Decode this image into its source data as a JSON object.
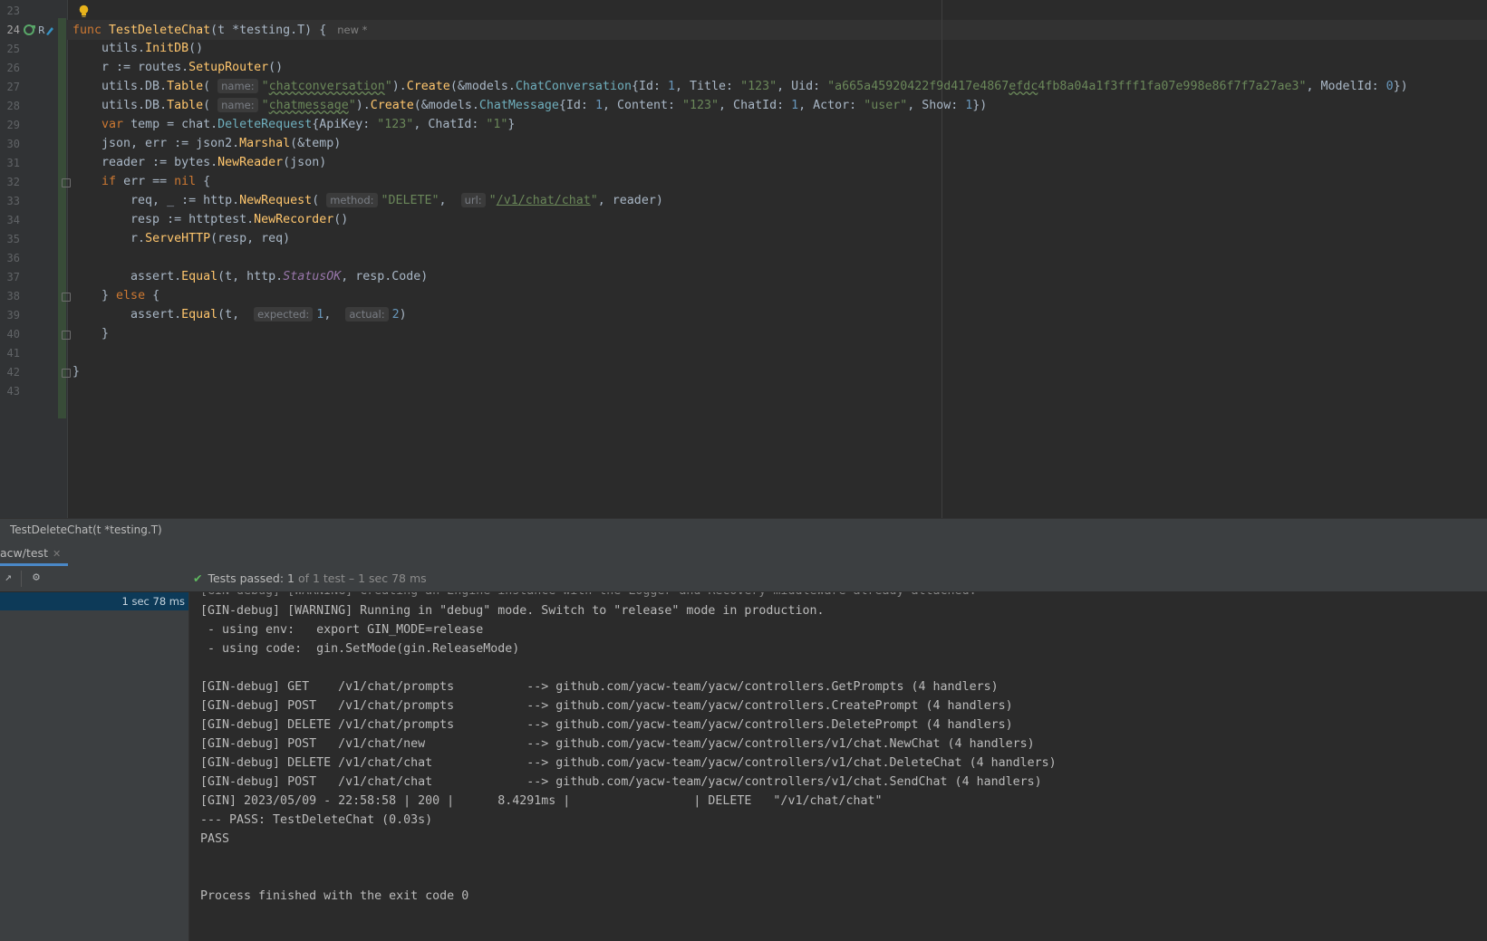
{
  "editor": {
    "lines": [
      {
        "n": "23",
        "segs": []
      },
      {
        "n": "24",
        "current": true,
        "segs": [
          {
            "t": "func ",
            "c": "kw"
          },
          {
            "t": "TestDeleteChat",
            "c": "fn"
          },
          {
            "t": "(t *testing.T) {"
          },
          {
            "t": "new *",
            "c": "inlay"
          }
        ]
      },
      {
        "n": "25",
        "segs": [
          {
            "t": "    utils."
          },
          {
            "t": "InitDB",
            "c": "call"
          },
          {
            "t": "()"
          }
        ]
      },
      {
        "n": "26",
        "segs": [
          {
            "t": "    r := routes."
          },
          {
            "t": "SetupRouter",
            "c": "call"
          },
          {
            "t": "()"
          }
        ]
      },
      {
        "n": "27",
        "segs": [
          {
            "t": "    utils.DB."
          },
          {
            "t": "Table",
            "c": "call"
          },
          {
            "t": "( "
          },
          {
            "t": "name:",
            "c": "hint"
          },
          {
            "t": "\"",
            "c": "str"
          },
          {
            "t": "chatconversation",
            "c": "str squig"
          },
          {
            "t": "\"",
            "c": "str"
          },
          {
            "t": ")."
          },
          {
            "t": "Create",
            "c": "call"
          },
          {
            "t": "(&models."
          },
          {
            "t": "ChatConversation",
            "c": "typ"
          },
          {
            "t": "{Id: "
          },
          {
            "t": "1",
            "c": "num"
          },
          {
            "t": ", Title: "
          },
          {
            "t": "\"123\"",
            "c": "str"
          },
          {
            "t": ", Uid: "
          },
          {
            "t": "\"a665a45920422f9d417e4867",
            "c": "str"
          },
          {
            "t": "efdc",
            "c": "str squig"
          },
          {
            "t": "4fb8a04a1f3fff1fa07e998e86f7f7a27ae3\"",
            "c": "str"
          },
          {
            "t": ", ModelId: "
          },
          {
            "t": "0",
            "c": "num"
          },
          {
            "t": "})"
          }
        ]
      },
      {
        "n": "28",
        "segs": [
          {
            "t": "    utils.DB."
          },
          {
            "t": "Table",
            "c": "call"
          },
          {
            "t": "( "
          },
          {
            "t": "name:",
            "c": "hint"
          },
          {
            "t": "\"",
            "c": "str"
          },
          {
            "t": "chatmessage",
            "c": "str squig"
          },
          {
            "t": "\"",
            "c": "str"
          },
          {
            "t": ")."
          },
          {
            "t": "Create",
            "c": "call"
          },
          {
            "t": "(&models."
          },
          {
            "t": "ChatMessage",
            "c": "typ"
          },
          {
            "t": "{Id: "
          },
          {
            "t": "1",
            "c": "num"
          },
          {
            "t": ", Content: "
          },
          {
            "t": "\"123\"",
            "c": "str"
          },
          {
            "t": ", ChatId: "
          },
          {
            "t": "1",
            "c": "num"
          },
          {
            "t": ", Actor: "
          },
          {
            "t": "\"user\"",
            "c": "str"
          },
          {
            "t": ", Show: "
          },
          {
            "t": "1",
            "c": "num"
          },
          {
            "t": "})"
          }
        ]
      },
      {
        "n": "29",
        "segs": [
          {
            "t": "    "
          },
          {
            "t": "var ",
            "c": "kw"
          },
          {
            "t": "temp = chat."
          },
          {
            "t": "DeleteRequest",
            "c": "typ"
          },
          {
            "t": "{ApiKey: "
          },
          {
            "t": "\"123\"",
            "c": "str"
          },
          {
            "t": ", ChatId: "
          },
          {
            "t": "\"1\"",
            "c": "str"
          },
          {
            "t": "}"
          }
        ]
      },
      {
        "n": "30",
        "segs": [
          {
            "t": "    json, err := json2."
          },
          {
            "t": "Marshal",
            "c": "call"
          },
          {
            "t": "(&temp)"
          }
        ]
      },
      {
        "n": "31",
        "segs": [
          {
            "t": "    reader := bytes."
          },
          {
            "t": "NewReader",
            "c": "call"
          },
          {
            "t": "(json)"
          }
        ]
      },
      {
        "n": "32",
        "fold": true,
        "segs": [
          {
            "t": "    "
          },
          {
            "t": "if ",
            "c": "kw"
          },
          {
            "t": "err == "
          },
          {
            "t": "nil",
            "c": "kw"
          },
          {
            "t": " {"
          }
        ]
      },
      {
        "n": "33",
        "segs": [
          {
            "t": "        req, _ := http."
          },
          {
            "t": "NewRequest",
            "c": "call"
          },
          {
            "t": "( "
          },
          {
            "t": "method:",
            "c": "hint"
          },
          {
            "t": "\"DELETE\"",
            "c": "str"
          },
          {
            "t": ",  "
          },
          {
            "t": "url:",
            "c": "hint"
          },
          {
            "t": "\"",
            "c": "str"
          },
          {
            "t": "/v1/chat/chat",
            "c": "str link"
          },
          {
            "t": "\"",
            "c": "str"
          },
          {
            "t": ", reader)"
          }
        ]
      },
      {
        "n": "34",
        "segs": [
          {
            "t": "        resp := httptest."
          },
          {
            "t": "NewRecorder",
            "c": "call"
          },
          {
            "t": "()"
          }
        ]
      },
      {
        "n": "35",
        "segs": [
          {
            "t": "        r."
          },
          {
            "t": "ServeHTTP",
            "c": "call"
          },
          {
            "t": "(resp, req)"
          }
        ]
      },
      {
        "n": "36",
        "segs": []
      },
      {
        "n": "37",
        "segs": [
          {
            "t": "        assert."
          },
          {
            "t": "Equal",
            "c": "call"
          },
          {
            "t": "(t, http."
          },
          {
            "t": "StatusOK",
            "c": "const"
          },
          {
            "t": ", resp.Code)"
          }
        ]
      },
      {
        "n": "38",
        "fold": true,
        "segs": [
          {
            "t": "    } "
          },
          {
            "t": "else",
            "c": "kw"
          },
          {
            "t": " {"
          }
        ]
      },
      {
        "n": "39",
        "segs": [
          {
            "t": "        assert."
          },
          {
            "t": "Equal",
            "c": "call"
          },
          {
            "t": "(t,  "
          },
          {
            "t": "expected:",
            "c": "hint"
          },
          {
            "t": "1",
            "c": "num"
          },
          {
            "t": ",  "
          },
          {
            "t": "actual:",
            "c": "hint"
          },
          {
            "t": "2",
            "c": "num"
          },
          {
            "t": ")"
          }
        ]
      },
      {
        "n": "40",
        "fold": true,
        "segs": [
          {
            "t": "    }"
          }
        ]
      },
      {
        "n": "41",
        "segs": []
      },
      {
        "n": "42",
        "fold": true,
        "segs": [
          {
            "t": "}"
          }
        ]
      },
      {
        "n": "43",
        "segs": []
      }
    ]
  },
  "breadcrumb": "TestDeleteChat(t *testing.T)",
  "run_panel": {
    "tab_label": "acw/test",
    "status_main": "Tests passed: 1",
    "status_sub": "of 1 test – 1 sec 78 ms",
    "tree_time": "1 sec 78 ms",
    "console_lines": [
      "[GIN-debug] [WARNING] Running in \"debug\" mode. Switch to \"release\" mode in production.",
      " - using env:   export GIN_MODE=release",
      " - using code:  gin.SetMode(gin.ReleaseMode)",
      "",
      "[GIN-debug] GET    /v1/chat/prompts          --> github.com/yacw-team/yacw/controllers.GetPrompts (4 handlers)",
      "[GIN-debug] POST   /v1/chat/prompts          --> github.com/yacw-team/yacw/controllers.CreatePrompt (4 handlers)",
      "[GIN-debug] DELETE /v1/chat/prompts          --> github.com/yacw-team/yacw/controllers.DeletePrompt (4 handlers)",
      "[GIN-debug] POST   /v1/chat/new              --> github.com/yacw-team/yacw/controllers/v1/chat.NewChat (4 handlers)",
      "[GIN-debug] DELETE /v1/chat/chat             --> github.com/yacw-team/yacw/controllers/v1/chat.DeleteChat (4 handlers)",
      "[GIN-debug] POST   /v1/chat/chat             --> github.com/yacw-team/yacw/controllers/v1/chat.SendChat (4 handlers)",
      "[GIN] 2023/05/09 - 22:58:58 | 200 |      8.4291ms |                 | DELETE   \"/v1/chat/chat\"",
      "--- PASS: TestDeleteChat (0.03s)",
      "PASS",
      "",
      "",
      "Process finished with the exit code 0"
    ]
  },
  "icons": {
    "bulb": "lightbulb-icon",
    "run": "run-test-icon",
    "open_external": "open-external-icon",
    "settings": "gear-icon",
    "check": "check-icon"
  },
  "colors": {
    "background": "#2b2b2b",
    "keyword": "#cc7832",
    "function": "#ffc66d",
    "string": "#6a8759",
    "number": "#6897bb",
    "pass": "#5fb85f",
    "selection": "#0d3a58"
  }
}
